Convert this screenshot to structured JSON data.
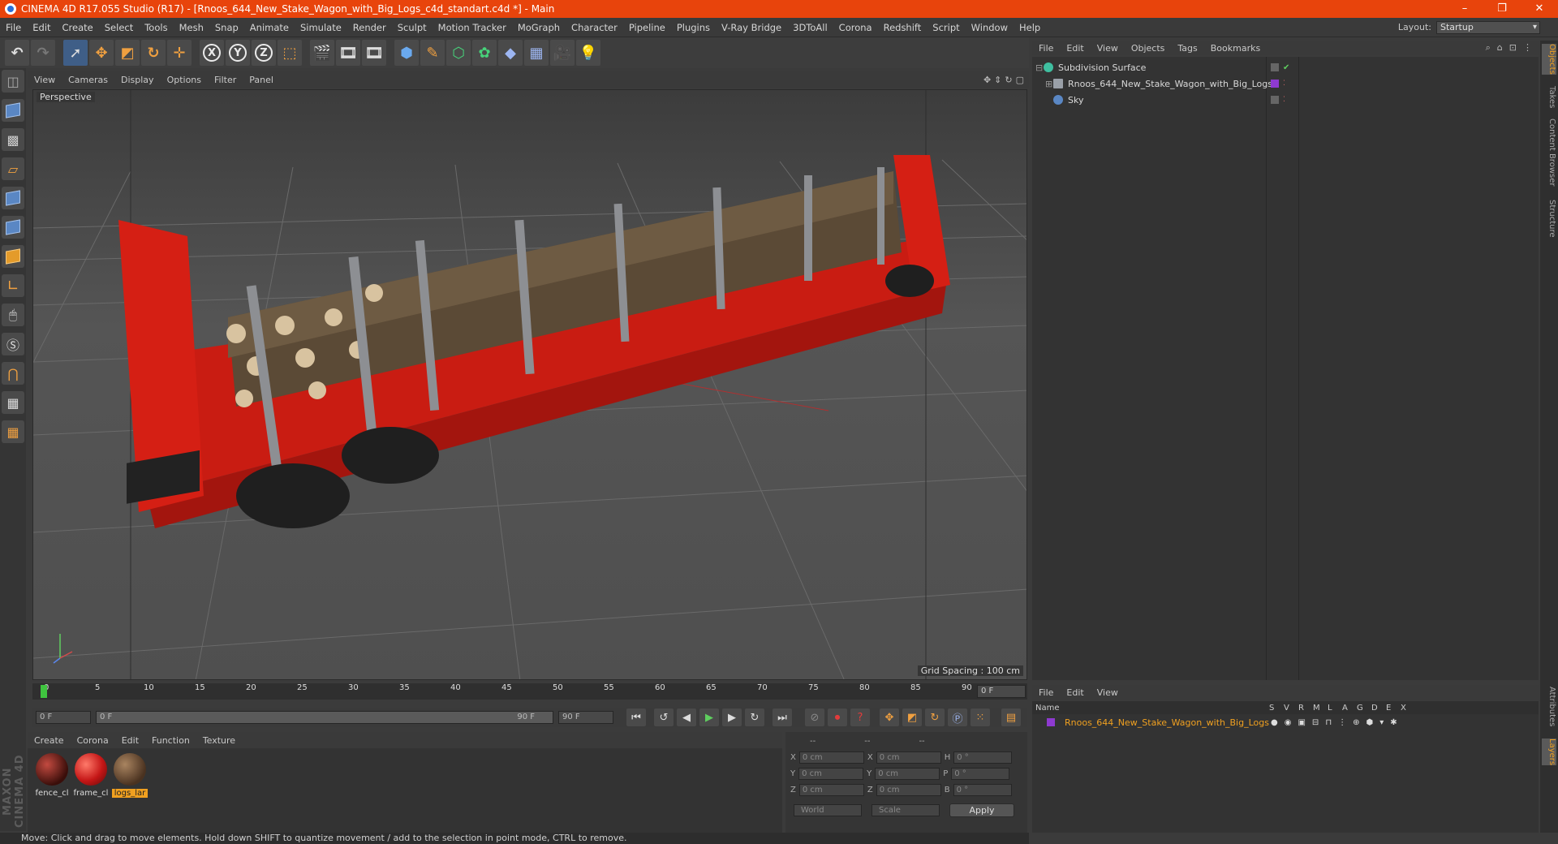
{
  "window": {
    "title": "CINEMA 4D R17.055 Studio (R17) - [Rnoos_644_New_Stake_Wagon_with_Big_Logs_c4d_standart.c4d *] - Main",
    "buttons": [
      "–",
      "❐",
      "✕"
    ]
  },
  "menubar": {
    "items": [
      "File",
      "Edit",
      "Create",
      "Select",
      "Tools",
      "Mesh",
      "Snap",
      "Animate",
      "Simulate",
      "Render",
      "Sculpt",
      "Motion Tracker",
      "MoGraph",
      "Character",
      "Pipeline",
      "Plugins",
      "V-Ray Bridge",
      "3DToAll",
      "Corona",
      "Redshift",
      "Script",
      "Window",
      "Help"
    ],
    "layout_label": "Layout:",
    "layout_value": "Startup"
  },
  "toolbar": {
    "axis_x": "X",
    "axis_y": "Y",
    "axis_z": "Z"
  },
  "viewport": {
    "menu": [
      "View",
      "Cameras",
      "Display",
      "Options",
      "Filter",
      "Panel"
    ],
    "label": "Perspective",
    "grid_spacing": "Grid Spacing : 100 cm",
    "accent": "#e8440c"
  },
  "timeline": {
    "ticks": [
      "0",
      "5",
      "10",
      "15",
      "20",
      "25",
      "30",
      "35",
      "40",
      "45",
      "50",
      "55",
      "60",
      "65",
      "70",
      "75",
      "80",
      "85",
      "90"
    ],
    "current_frame": "0 F",
    "start_field": "0 F",
    "range_start": "0 F",
    "range_end": "90 F",
    "end_field": "90 F"
  },
  "materials": {
    "menu": [
      "Create",
      "Corona",
      "Edit",
      "Function",
      "Texture"
    ],
    "items": [
      {
        "name": "fence_cl",
        "color": "#7a1c14"
      },
      {
        "name": "frame_cl",
        "color": "#d42020"
      },
      {
        "name": "logs_lar",
        "color": "#6b4a2c"
      }
    ]
  },
  "coords": {
    "header": [
      "--",
      "--",
      "--"
    ],
    "rows": [
      {
        "a": "X",
        "av": "0 cm",
        "b": "X",
        "bv": "0 cm",
        "c": "H",
        "cv": "0 °"
      },
      {
        "a": "Y",
        "av": "0 cm",
        "b": "Y",
        "bv": "0 cm",
        "c": "P",
        "cv": "0 °"
      },
      {
        "a": "Z",
        "av": "0 cm",
        "b": "Z",
        "bv": "0 cm",
        "c": "B",
        "cv": "0 °"
      }
    ],
    "world": "World",
    "scale": "Scale",
    "apply": "Apply"
  },
  "status": "Move: Click and drag to move elements. Hold down SHIFT to quantize movement / add to the selection in point mode, CTRL to remove.",
  "objects": {
    "menu": [
      "File",
      "Edit",
      "View",
      "Objects",
      "Tags",
      "Bookmarks"
    ],
    "rows": [
      {
        "name": "Subdivision Surface",
        "icon_color": "#3fbfa0"
      },
      {
        "name": "Rnoos_644_New_Stake_Wagon_with_Big_Logs",
        "icon_color": "#9aa0a8"
      },
      {
        "name": "Sky",
        "icon_color": "#5a87c4"
      }
    ]
  },
  "side_tabs": [
    "Objects",
    "Takes",
    "Content Browser",
    "Structure",
    "Attributes",
    "Layers"
  ],
  "layers": {
    "menu": [
      "File",
      "Edit",
      "View"
    ],
    "columns": [
      "Name",
      "S",
      "V",
      "R",
      "M",
      "L",
      "A",
      "G",
      "D",
      "E",
      "X"
    ],
    "row_name": "Rnoos_644_New_Stake_Wagon_with_Big_Logs"
  },
  "branding": "MAXON CINEMA 4D"
}
